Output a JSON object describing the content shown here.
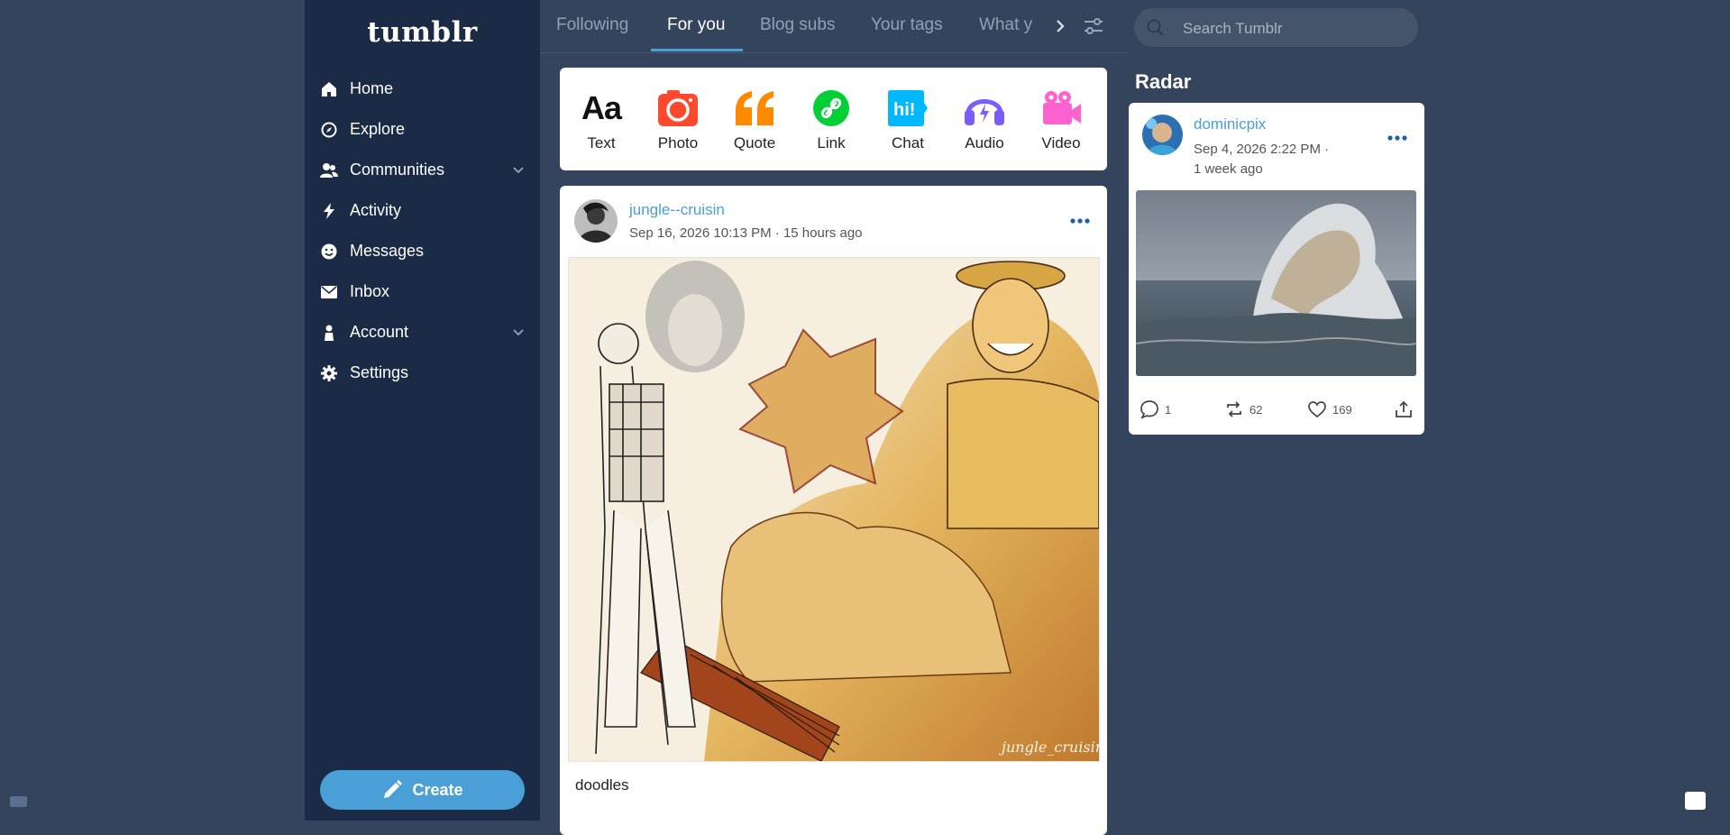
{
  "sidebar": {
    "logo": "tumblr",
    "items": [
      {
        "label": "Home",
        "icon": "home-icon"
      },
      {
        "label": "Explore",
        "icon": "compass-icon"
      },
      {
        "label": "Communities",
        "icon": "people-icon",
        "expandable": true
      },
      {
        "label": "Activity",
        "icon": "lightning-icon"
      },
      {
        "label": "Messages",
        "icon": "smiley-icon"
      },
      {
        "label": "Inbox",
        "icon": "envelope-icon"
      },
      {
        "label": "Account",
        "icon": "person-icon",
        "expandable": true
      },
      {
        "label": "Settings",
        "icon": "gear-icon"
      }
    ],
    "create_label": "Create"
  },
  "tabs": {
    "items": [
      "Following",
      "For you",
      "Blog subs",
      "Your tags",
      "What y"
    ],
    "active": "For you"
  },
  "composer": {
    "types": [
      {
        "label": "Text",
        "icon": "text-icon",
        "color": "#111111"
      },
      {
        "label": "Photo",
        "icon": "camera-icon",
        "color": "#ff492f"
      },
      {
        "label": "Quote",
        "icon": "quote-icon",
        "color": "#ff8a00"
      },
      {
        "label": "Link",
        "icon": "link-icon",
        "color": "#00cf35"
      },
      {
        "label": "Chat",
        "icon": "chat-icon",
        "color": "#00b8ff"
      },
      {
        "label": "Audio",
        "icon": "headphones-icon",
        "color": "#7c5cff"
      },
      {
        "label": "Video",
        "icon": "video-camera-icon",
        "color": "#ff62ce"
      }
    ]
  },
  "post": {
    "blog_name": "jungle--cruisin",
    "meta": "Sep 16, 2026 10:13 PM · 15 hours ago",
    "image_signature": "jungle_cruisin",
    "caption": "doodles"
  },
  "search": {
    "placeholder": "Search Tumblr"
  },
  "radar": {
    "title": "Radar",
    "blog_name": "dominicpix",
    "date_line1": "Sep 4, 2026 2:22 PM ·",
    "date_line2": "1 week ago",
    "replies": "1",
    "reblogs": "62",
    "likes": "169"
  },
  "colors": {
    "background": "#35445d",
    "sidebar": "#1b2a45",
    "accent": "#4aa0d6"
  }
}
